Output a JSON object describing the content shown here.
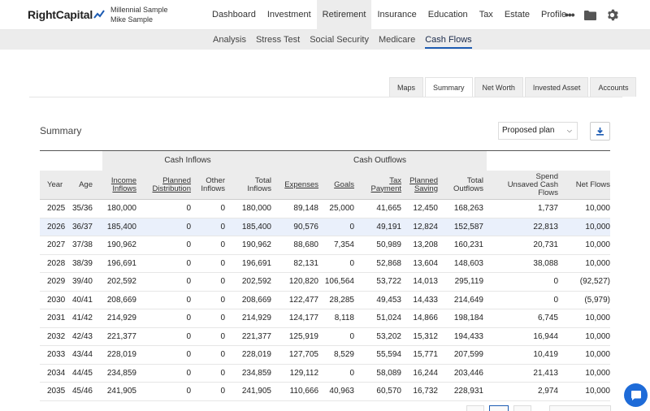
{
  "brand": {
    "name_a": "Right",
    "name_b": "Capital"
  },
  "client": {
    "line1": "Millennial Sample",
    "line2": "Mike Sample"
  },
  "nav": [
    "Dashboard",
    "Investment",
    "Retirement",
    "Insurance",
    "Education",
    "Tax",
    "Estate",
    "Profile"
  ],
  "nav_active": "Retirement",
  "subnav": [
    "Analysis",
    "Stress Test",
    "Social Security",
    "Medicare",
    "Cash Flows"
  ],
  "subnav_active": "Cash Flows",
  "view_tabs": [
    "Maps",
    "Summary",
    "Net Worth",
    "Invested Asset",
    "Accounts"
  ],
  "view_active": "Summary",
  "summary": {
    "title": "Summary",
    "plan": "Proposed plan"
  },
  "groups": {
    "inflows": "Cash Inflows",
    "outflows": "Cash Outflows"
  },
  "columns": [
    {
      "l1": "",
      "l2": "Year",
      "u": false
    },
    {
      "l1": "",
      "l2": "Age",
      "u": false
    },
    {
      "l1": "Income",
      "l2": "Inflows",
      "u": true
    },
    {
      "l1": "Planned",
      "l2": "Distribution",
      "u": true
    },
    {
      "l1": "Other",
      "l2": "Inflows",
      "u": false
    },
    {
      "l1": "Total",
      "l2": "Inflows",
      "u": false
    },
    {
      "l1": "",
      "l2": "Expenses",
      "u": true
    },
    {
      "l1": "",
      "l2": "Goals",
      "u": true
    },
    {
      "l1": "Tax",
      "l2": "Payment",
      "u": true
    },
    {
      "l1": "Planned",
      "l2": "Saving",
      "u": true
    },
    {
      "l1": "Total",
      "l2": "Outflows",
      "u": false
    },
    {
      "l1": "Spend\nUnsaved Cash",
      "l2": "Flows",
      "u": false
    },
    {
      "l1": "",
      "l2": "Net Flows",
      "u": false
    }
  ],
  "rows": [
    [
      "2025",
      "35/36",
      "180,000",
      "0",
      "0",
      "180,000",
      "89,148",
      "25,000",
      "41,665",
      "12,450",
      "168,263",
      "1,737",
      "10,000"
    ],
    [
      "2026",
      "36/37",
      "185,400",
      "0",
      "0",
      "185,400",
      "90,576",
      "0",
      "49,191",
      "12,824",
      "152,587",
      "22,813",
      "10,000"
    ],
    [
      "2027",
      "37/38",
      "190,962",
      "0",
      "0",
      "190,962",
      "88,680",
      "7,354",
      "50,989",
      "13,208",
      "160,231",
      "20,731",
      "10,000"
    ],
    [
      "2028",
      "38/39",
      "196,691",
      "0",
      "0",
      "196,691",
      "82,131",
      "0",
      "52,868",
      "13,604",
      "148,603",
      "38,088",
      "10,000"
    ],
    [
      "2029",
      "39/40",
      "202,592",
      "0",
      "0",
      "202,592",
      "120,820",
      "106,564",
      "53,722",
      "14,013",
      "295,119",
      "0",
      "(92,527)"
    ],
    [
      "2030",
      "40/41",
      "208,669",
      "0",
      "0",
      "208,669",
      "122,477",
      "28,285",
      "49,453",
      "14,433",
      "214,649",
      "0",
      "(5,979)"
    ],
    [
      "2031",
      "41/42",
      "214,929",
      "0",
      "0",
      "214,929",
      "124,177",
      "8,118",
      "51,024",
      "14,866",
      "198,184",
      "6,745",
      "10,000"
    ],
    [
      "2032",
      "42/43",
      "221,377",
      "0",
      "0",
      "221,377",
      "125,919",
      "0",
      "53,202",
      "15,312",
      "194,433",
      "16,944",
      "10,000"
    ],
    [
      "2033",
      "43/44",
      "228,019",
      "0",
      "0",
      "228,019",
      "127,705",
      "8,529",
      "55,594",
      "15,771",
      "207,599",
      "10,419",
      "10,000"
    ],
    [
      "2034",
      "44/45",
      "234,859",
      "0",
      "0",
      "234,859",
      "129,112",
      "0",
      "58,089",
      "16,244",
      "203,446",
      "21,413",
      "10,000"
    ],
    [
      "2035",
      "45/46",
      "241,905",
      "0",
      "0",
      "241,905",
      "110,666",
      "40,963",
      "60,570",
      "16,732",
      "228,931",
      "2,974",
      "10,000"
    ]
  ],
  "highlight_row": 1,
  "colors": {
    "accent": "#1d5cb3",
    "chat": "#1e6bd8"
  }
}
